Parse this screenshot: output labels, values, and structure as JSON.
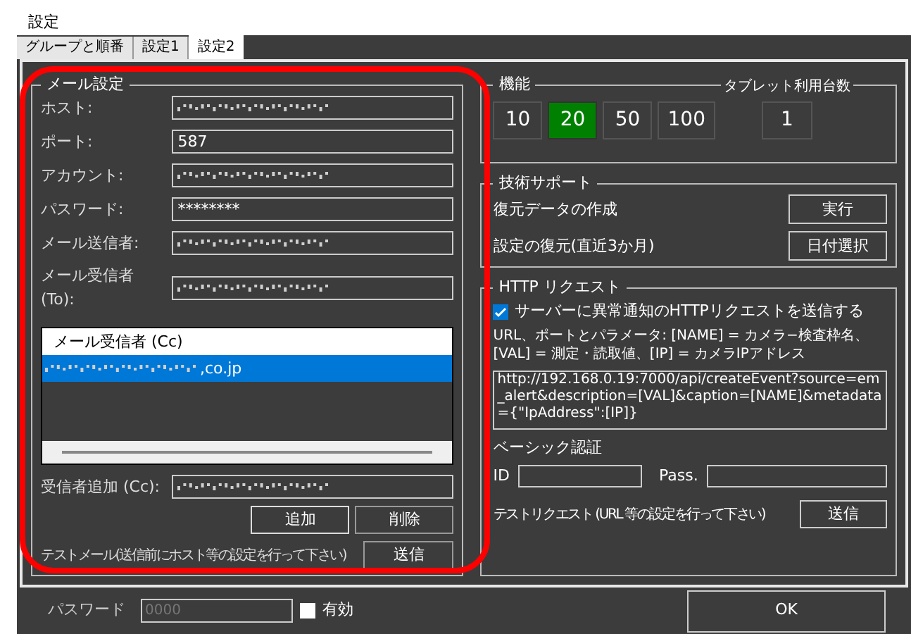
{
  "window": {
    "title": "設定"
  },
  "tabs": [
    {
      "label": "グループと順番",
      "selected": false
    },
    {
      "label": "設定1",
      "selected": false
    },
    {
      "label": "設定2",
      "selected": true
    }
  ],
  "mail": {
    "title": "メール設定",
    "fields": [
      {
        "label": "ホスト:",
        "redacted": true
      },
      {
        "label": "ポート:",
        "value": "587",
        "redacted": false
      },
      {
        "label": "アカウント:",
        "redacted": true
      },
      {
        "label": "パスワード:",
        "value": "********",
        "redacted": false
      },
      {
        "label": "メール送信者:",
        "redacted": true
      },
      {
        "label": "メール受信者 (To):",
        "redacted": true
      }
    ],
    "cc_list": {
      "header": "メール受信者 (Cc)",
      "items": [
        {
          "text": ",co.jp",
          "redacted_prefix": true,
          "selected": true
        }
      ]
    },
    "add_cc": {
      "label": "受信者追加 (Cc):",
      "redacted": true
    },
    "buttons": [
      "追加",
      "削除"
    ],
    "test": {
      "label": "テストメール(送信前にホスト等の設定を行って下さい)",
      "button": "送信"
    }
  },
  "features": {
    "title": "機能",
    "options": [
      {
        "label": "10",
        "selected": false
      },
      {
        "label": "20",
        "selected": true
      },
      {
        "label": "50",
        "selected": false
      },
      {
        "label": "100",
        "selected": false
      }
    ],
    "tablet_label": "タブレット利用台数",
    "tablet_count": "1"
  },
  "support": {
    "title": "技術サポート",
    "rows": [
      {
        "label": "復元データの作成",
        "button": "実行"
      },
      {
        "label": "設定の復元(直近3か月)",
        "button": "日付選択"
      }
    ]
  },
  "http": {
    "title": "HTTP リクエスト",
    "enable": {
      "label": "サーバーに異常通知のHTTPリクエストを送信する",
      "checked": true
    },
    "help": "URL、ポートとパラメータ: [NAME] = カメラ−検査枠名、[VAL] = 測定・読取値、[IP] = カメラIPアドレス",
    "url": "http://192.168.0.19:7000/api/createEvent?source=em_alert&description=[VAL]&caption=[NAME]&metadata={\"IpAddress\":[IP]}",
    "auth_title": "ベーシック認証",
    "id_label": "ID",
    "pass_label": "Pass.",
    "test": {
      "label": "テストリクエスト (URL 等の設定を行って下さい)",
      "button": "送信"
    }
  },
  "footer": {
    "password_label": "パスワード",
    "password_placeholder": "0000",
    "enabled": {
      "label": "有効",
      "checked": false
    },
    "ok": "OK"
  },
  "annotation": {
    "kind": "highlight-frame"
  }
}
